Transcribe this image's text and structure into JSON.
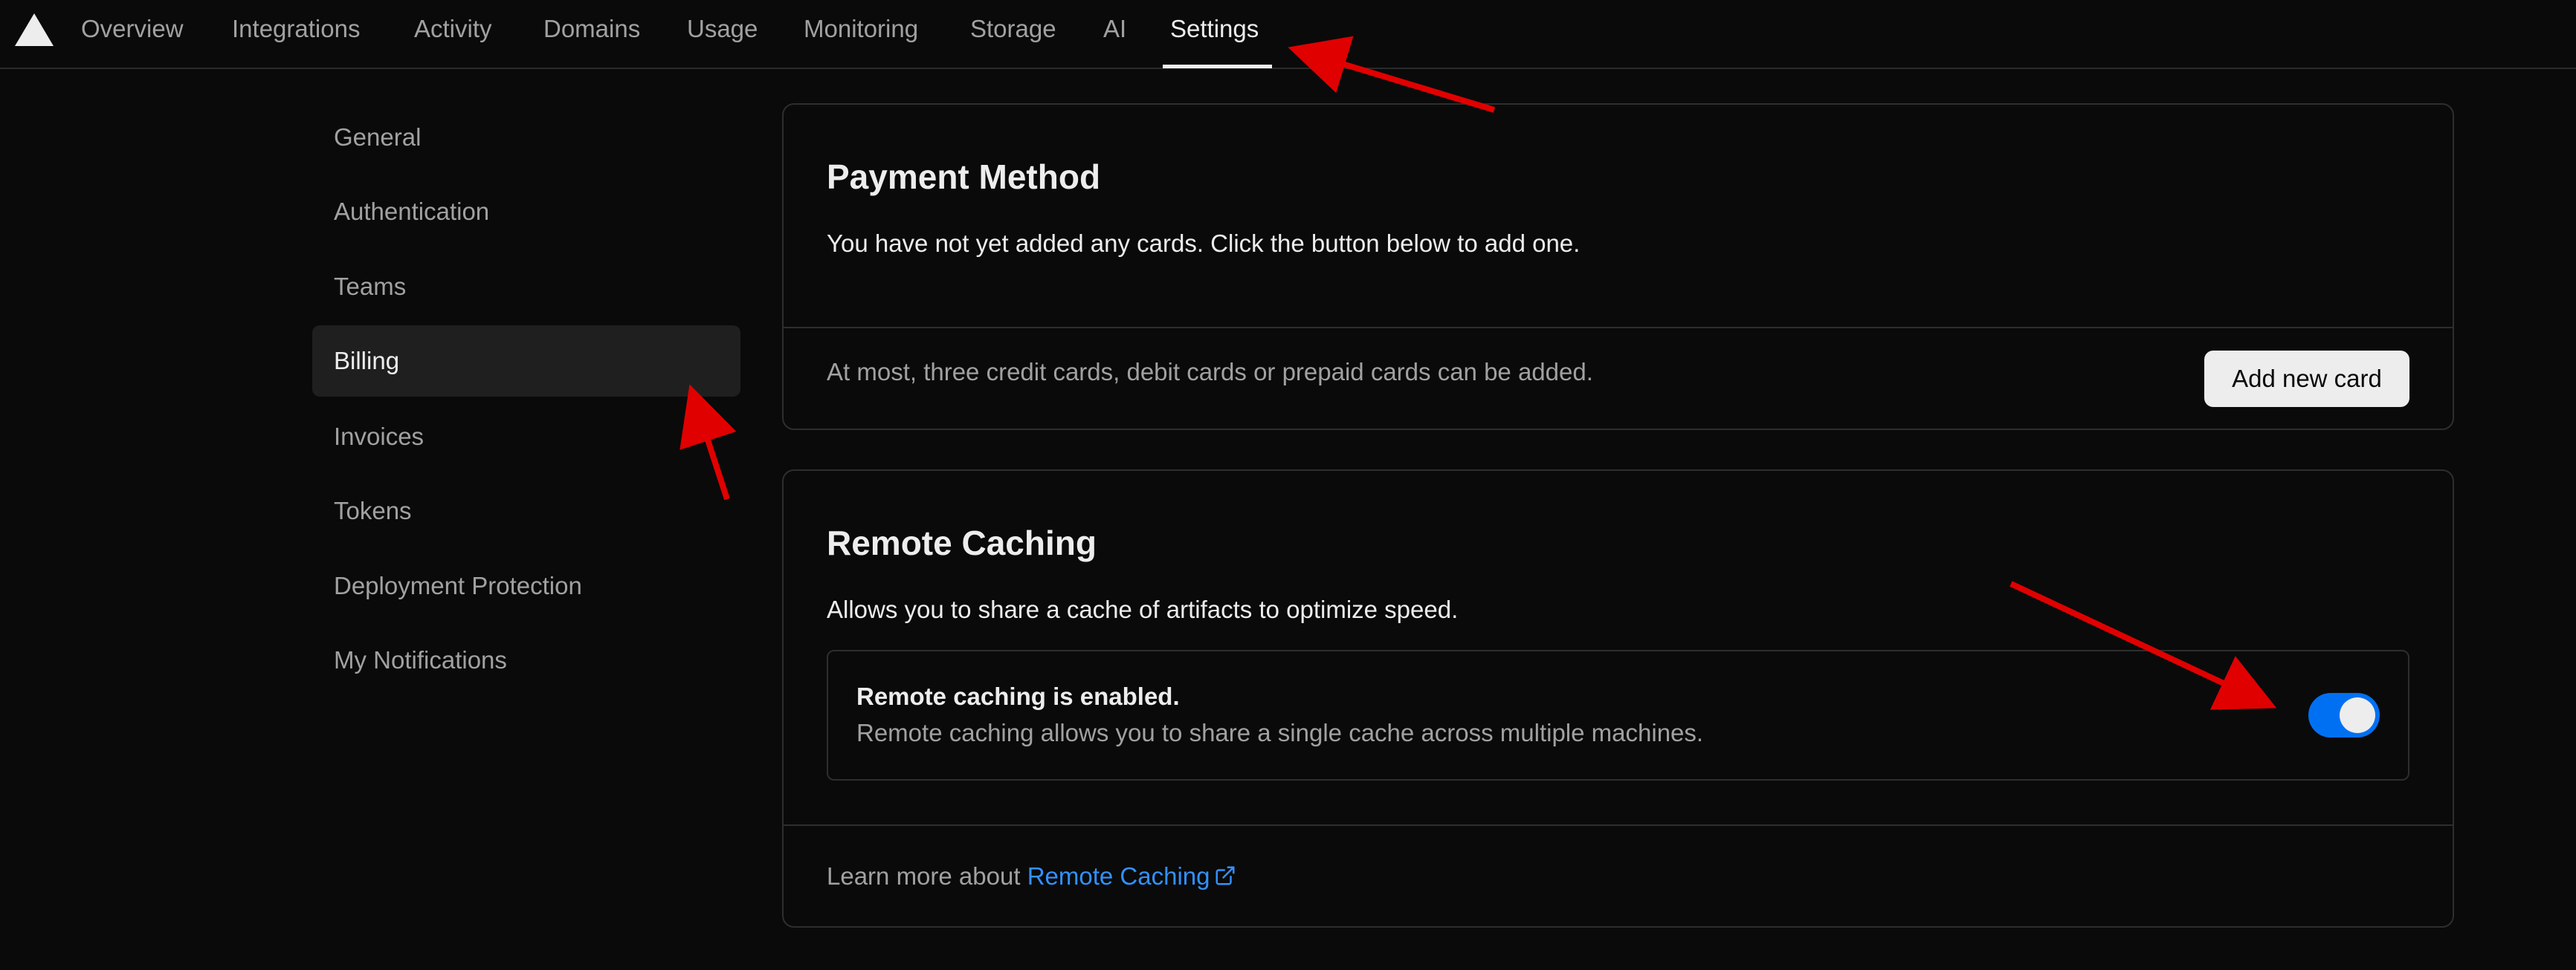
{
  "nav": {
    "tabs": [
      {
        "label": "Overview"
      },
      {
        "label": "Integrations"
      },
      {
        "label": "Activity"
      },
      {
        "label": "Domains"
      },
      {
        "label": "Usage"
      },
      {
        "label": "Monitoring"
      },
      {
        "label": "Storage"
      },
      {
        "label": "AI"
      },
      {
        "label": "Settings"
      }
    ],
    "active": "Settings"
  },
  "sidebar": {
    "items": [
      {
        "label": "General"
      },
      {
        "label": "Authentication"
      },
      {
        "label": "Teams"
      },
      {
        "label": "Billing"
      },
      {
        "label": "Invoices"
      },
      {
        "label": "Tokens"
      },
      {
        "label": "Deployment Protection"
      },
      {
        "label": "My Notifications"
      }
    ],
    "active": "Billing"
  },
  "payment": {
    "title": "Payment Method",
    "description": "You have not yet added any cards. Click the button below to add one.",
    "footer": "At most, three credit cards, debit cards or prepaid cards can be added.",
    "button": "Add new card"
  },
  "caching": {
    "title": "Remote Caching",
    "description": "Allows you to share a cache of artifacts to optimize speed.",
    "status_title": "Remote caching is enabled.",
    "status_sub": "Remote caching allows you to share a single cache across multiple machines.",
    "toggle_on": true,
    "footer_prefix": "Learn more about",
    "footer_link": "Remote Caching"
  },
  "colors": {
    "background": "#0a0a0a",
    "accent": "#0070f3",
    "link": "#3291ff",
    "annotation": "#e00000"
  },
  "icons": [
    "vercel-logo-icon",
    "external-link-icon"
  ]
}
